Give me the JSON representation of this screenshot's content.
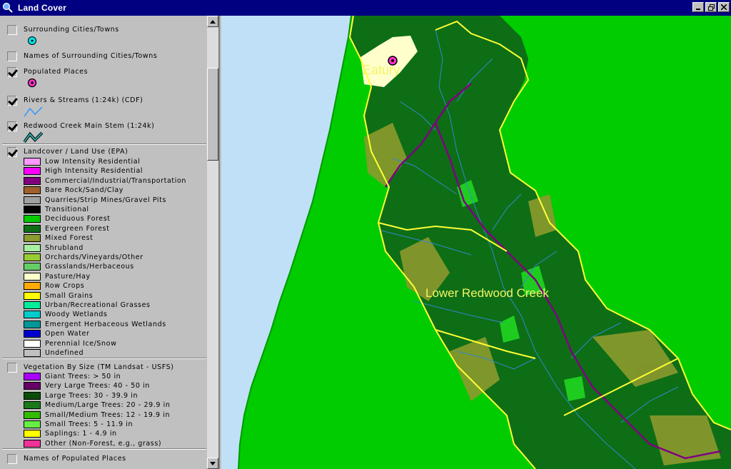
{
  "window": {
    "title": "Land Cover",
    "icon": "globe-magnifier-icon"
  },
  "legend": {
    "layers": [
      {
        "name": "Surrounding Cities/Towns",
        "checked": false,
        "symbol": "city-point-icon"
      },
      {
        "name": "Names of Surrounding Cities/Towns",
        "checked": false
      },
      {
        "name": "Populated Places",
        "checked": true,
        "symbol": "populated-place-icon"
      },
      {
        "name": "Rivers & Streams (1:24k) (CDF)",
        "checked": true,
        "symbol": "stream-line-icon"
      },
      {
        "name": "Redwood Creek Main Stem (1:24k)",
        "checked": true,
        "symbol": "main-stem-line-icon"
      },
      {
        "name": "Landcover / Land Use (EPA)",
        "checked": true
      },
      {
        "name": "Vegetation By Size (TM Landsat - USFS)",
        "checked": false
      },
      {
        "name": "Names of Populated Places",
        "checked": false
      }
    ],
    "landcover_classes": [
      {
        "label": "Low Intensity Residential",
        "color": "#ff99ff"
      },
      {
        "label": "High Intensity Residential",
        "color": "#ff00ff"
      },
      {
        "label": "Commercial/Industrial/Transportation",
        "color": "#800080"
      },
      {
        "label": "Bare Rock/Sand/Clay",
        "color": "#a0602c"
      },
      {
        "label": "Quarries/Strip Mines/Gravel Pits",
        "color": "#a0a0a0"
      },
      {
        "label": "Transitional",
        "color": "#000000"
      },
      {
        "label": "Deciduous Forest",
        "color": "#00cc00"
      },
      {
        "label": "Evergreen Forest",
        "color": "#0d6e16"
      },
      {
        "label": "Mixed Forest",
        "color": "#8c9a2e"
      },
      {
        "label": "Shrubland",
        "color": "#a8f0a0"
      },
      {
        "label": "Orchards/Vineyards/Other",
        "color": "#99cc33"
      },
      {
        "label": "Grasslands/Herbaceous",
        "color": "#66cc66"
      },
      {
        "label": "Pasture/Hay",
        "color": "#ffffcc"
      },
      {
        "label": "Row Crops",
        "color": "#ffaa00"
      },
      {
        "label": "Small Grains",
        "color": "#ffff00"
      },
      {
        "label": "Urban/Recreational Grasses",
        "color": "#00ee99"
      },
      {
        "label": "Woody Wetlands",
        "color": "#00cccc"
      },
      {
        "label": "Emergent Herbaceous Wetlands",
        "color": "#009999"
      },
      {
        "label": "Open Water",
        "color": "#0000cc"
      },
      {
        "label": "Perennial Ice/Snow",
        "color": "#ffffff"
      },
      {
        "label": "Undefined",
        "color": "#c0c0c0"
      }
    ],
    "vegetation_classes": [
      {
        "label": "Giant Trees: > 50 in",
        "color": "#aa00ff"
      },
      {
        "label": "Very Large Trees: 40 - 50 in",
        "color": "#660066"
      },
      {
        "label": "Large Trees: 30 - 39.9 in",
        "color": "#0a4d0a"
      },
      {
        "label": "Medium/Large Trees: 20 - 29.9 in",
        "color": "#1a7a1a"
      },
      {
        "label": "Small/Medium Trees: 12 - 19.9 in",
        "color": "#33bb00"
      },
      {
        "label": "Small Trees: 5 - 11.9 in",
        "color": "#66ee44"
      },
      {
        "label": "Saplings: 1 - 4.9 in",
        "color": "#ffff00"
      },
      {
        "label": "Other (Non-Forest, e.g., grass)",
        "color": "#ee3399"
      }
    ]
  },
  "map": {
    "labels": {
      "town": "Eatury",
      "watershed": "Lower Redwood Creek"
    },
    "colors": {
      "ocean": "#c0e0f8",
      "land": "#00cc00",
      "boundary": "#ffff33",
      "forest": "#0d6e16",
      "stream": "#3388cc",
      "main_stem": "#800080"
    }
  }
}
